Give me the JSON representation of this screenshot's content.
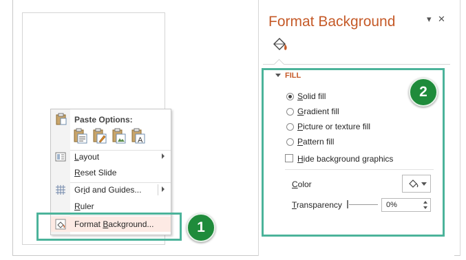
{
  "context_menu": {
    "paste_header": "Paste Options:",
    "paste_icons": [
      "paste-use-destination-theme-icon",
      "paste-keep-source-formatting-icon",
      "paste-picture-icon",
      "paste-keep-text-only-icon"
    ],
    "items": [
      {
        "prefix": "",
        "accel": "L",
        "rest": "ayout"
      },
      {
        "prefix": "",
        "accel": "R",
        "rest": "eset Slide"
      },
      {
        "prefix": "Gr",
        "accel": "i",
        "rest": "d and Guides..."
      },
      {
        "prefix": "",
        "accel": "R",
        "rest": "uler"
      },
      {
        "prefix": "Format ",
        "accel": "B",
        "rest": "ackground..."
      }
    ]
  },
  "callouts": {
    "one": "1",
    "two": "2"
  },
  "pane": {
    "title": "Format Background",
    "dropdown_glyph": "▾",
    "close_glyph": "✕",
    "section_title": "FILL",
    "fill_options": [
      {
        "accel": "S",
        "rest": "olid fill",
        "selected": true
      },
      {
        "accel": "G",
        "rest": "radient fill",
        "selected": false
      },
      {
        "accel": "P",
        "rest": "icture or texture fill",
        "selected": false
      },
      {
        "accel": "P",
        "rest": "attern fill",
        "selected": false
      }
    ],
    "hide_bg": {
      "accel": "H",
      "rest": "ide background graphics",
      "checked": false
    },
    "color": {
      "accel": "C",
      "rest": "olor"
    },
    "transparency": {
      "accel": "T",
      "rest": "ransparency",
      "value": "0%"
    }
  },
  "colors": {
    "accent": "#c55a28",
    "highlight": "#4bb39a",
    "badge": "#1f8b3b"
  }
}
